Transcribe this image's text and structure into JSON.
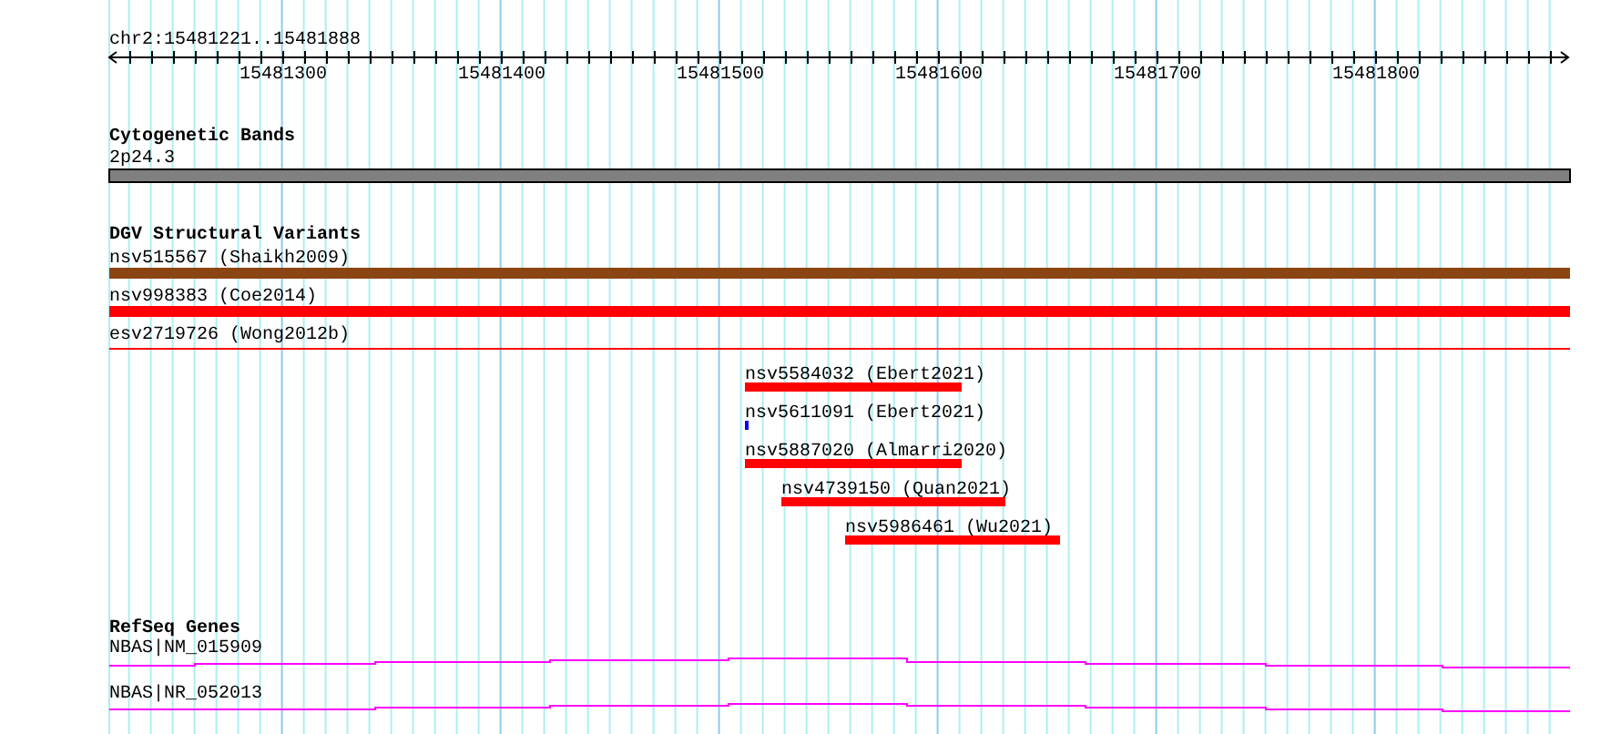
{
  "ruler": {
    "label": "chr2:15481221..15481888",
    "ticks": [
      "15481300",
      "15481400",
      "15481500",
      "15481600",
      "15481700",
      "15481800"
    ]
  },
  "tracks": [
    {
      "title": "Cytogenetic Bands",
      "features": [
        {
          "label": "2p24.3",
          "kind": "band"
        }
      ]
    },
    {
      "title": "DGV Structural Variants",
      "features": [
        {
          "label": "nsv515567 (Shaikh2009)",
          "kind": "bar",
          "color": "#8b4513"
        },
        {
          "label": "nsv998383 (Coe2014)",
          "kind": "bar",
          "color": "#ff0000"
        },
        {
          "label": "esv2719726 (Wong2012b)",
          "kind": "line",
          "color": "#ff0000"
        },
        {
          "label": "nsv5584032 (Ebert2021)",
          "kind": "bar",
          "color": "#ff0000"
        },
        {
          "label": "nsv5611091 (Ebert2021)",
          "kind": "bar",
          "color": "#0000ff"
        },
        {
          "label": "nsv5887020 (Almarri2020)",
          "kind": "bar",
          "color": "#ff0000"
        },
        {
          "label": "nsv4739150 (Quan2021)",
          "kind": "bar",
          "color": "#ff0000"
        },
        {
          "label": "nsv5986461 (Wu2021)",
          "kind": "bar",
          "color": "#ff0000"
        }
      ]
    },
    {
      "title": "RefSeq Genes",
      "features": [
        {
          "label": "NBAS|NM_015909",
          "kind": "transcript"
        },
        {
          "label": "NBAS|NR_052013",
          "kind": "transcript"
        }
      ]
    }
  ]
}
